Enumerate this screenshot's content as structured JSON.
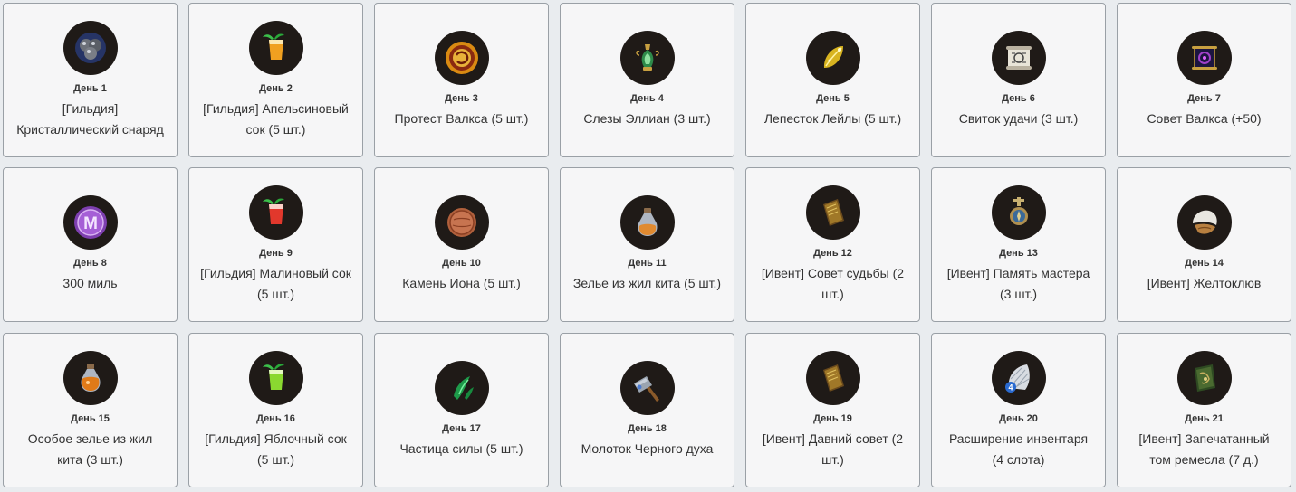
{
  "rewards": [
    {
      "day": "День 1",
      "name": "[Гильдия] Кристаллический снаряд",
      "icon": "crystal-shot-icon"
    },
    {
      "day": "День 2",
      "name": "[Гильдия] Апельсиновый сок (5 шт.)",
      "icon": "orange-juice-icon"
    },
    {
      "day": "День 3",
      "name": "Протест Валкса (5 шт.)",
      "icon": "valks-protest-icon"
    },
    {
      "day": "День 4",
      "name": "Слезы Эллиан (3 шт.)",
      "icon": "ellian-tears-icon"
    },
    {
      "day": "День 5",
      "name": "Лепесток Лейлы (5 шт.)",
      "icon": "leila-petal-icon"
    },
    {
      "day": "День 6",
      "name": "Свиток удачи (3 шт.)",
      "icon": "luck-scroll-icon"
    },
    {
      "day": "День 7",
      "name": "Совет Валкса (+50)",
      "icon": "valks-advice-icon"
    },
    {
      "day": "День 8",
      "name": "300 миль",
      "icon": "mileage-coin-icon"
    },
    {
      "day": "День 9",
      "name": "[Гильдия] Малиновый сок (5 шт.)",
      "icon": "raspberry-juice-icon"
    },
    {
      "day": "День 10",
      "name": "Камень Иона (5 шт.)",
      "icon": "ion-stone-icon"
    },
    {
      "day": "День 11",
      "name": "Зелье из жил кита (5 шт.)",
      "icon": "whale-potion-icon"
    },
    {
      "day": "День 12",
      "name": "[Ивент] Совет судьбы (2 шт.)",
      "icon": "fate-advice-book-icon"
    },
    {
      "day": "День 13",
      "name": "[Ивент] Память мастера (3 шт.)",
      "icon": "master-memory-icon"
    },
    {
      "day": "День 14",
      "name": "[Ивент] Желтоклюв",
      "icon": "yellowbeak-icon"
    },
    {
      "day": "День 15",
      "name": "Особое зелье из жил кита (3 шт.)",
      "icon": "special-whale-potion-icon"
    },
    {
      "day": "День 16",
      "name": "[Гильдия] Яблочный сок (5 шт.)",
      "icon": "apple-juice-icon"
    },
    {
      "day": "День 17",
      "name": "Частица силы (5 шт.)",
      "icon": "power-fragment-icon"
    },
    {
      "day": "День 18",
      "name": "Молоток Черного духа",
      "icon": "black-spirit-hammer-icon"
    },
    {
      "day": "День 19",
      "name": "[Ивент] Давний совет (2 шт.)",
      "icon": "old-advice-book-icon"
    },
    {
      "day": "День 20",
      "name": "Расширение инвентаря (4 слота)",
      "icon": "inventory-expansion-icon",
      "badge": "4"
    },
    {
      "day": "День 21",
      "name": "[Ивент] Запечатанный том ремесла (7 д.)",
      "icon": "sealed-craft-tome-icon"
    }
  ]
}
